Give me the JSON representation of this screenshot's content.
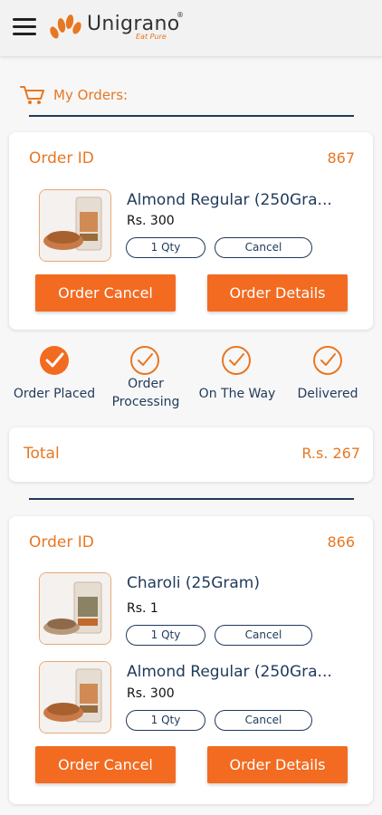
{
  "header": {
    "brand": "Unigrano",
    "registered": "®",
    "tagline": "Eat Pure"
  },
  "section": {
    "title": "My Orders:"
  },
  "colors": {
    "accent": "#f26b21",
    "text_orange": "#e87722",
    "navy": "#1f3a5a"
  },
  "orders": [
    {
      "id_label": "Order ID",
      "id": "867",
      "items": [
        {
          "name": "Almond Regular (250Gra...",
          "price": "Rs. 300",
          "qty": "1 Qty",
          "cancel": "Cancel"
        }
      ],
      "buttons": {
        "cancel": "Order Cancel",
        "details": "Order Details"
      },
      "status_steps": [
        {
          "label": "Order Placed",
          "done": true
        },
        {
          "label": "Order Processing",
          "done": false
        },
        {
          "label": "On The Way",
          "done": false
        },
        {
          "label": "Delivered",
          "done": false
        }
      ],
      "total_label": "Total",
      "total_value": "R.s. 267"
    },
    {
      "id_label": "Order ID",
      "id": "866",
      "items": [
        {
          "name": "Charoli (25Gram)",
          "price": "Rs. 1",
          "qty": "1 Qty",
          "cancel": "Cancel"
        },
        {
          "name": "Almond Regular (250Gra...",
          "price": "Rs. 300",
          "qty": "1 Qty",
          "cancel": "Cancel"
        }
      ],
      "buttons": {
        "cancel": "Order Cancel",
        "details": "Order Details"
      }
    }
  ]
}
